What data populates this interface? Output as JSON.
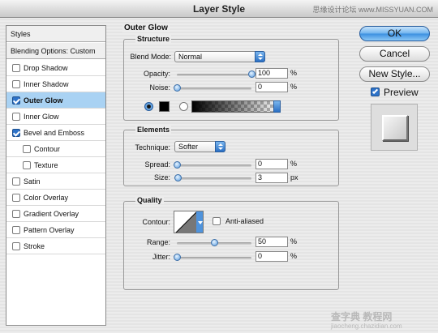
{
  "window": {
    "title": "Layer Style",
    "watermark": "思缘设计论坛 www.MISSYUAN.COM"
  },
  "styles_list": {
    "header": "Styles",
    "blending": "Blending Options: Custom",
    "items": [
      {
        "label": "Drop Shadow",
        "checked": false,
        "selected": false,
        "sub": false
      },
      {
        "label": "Inner Shadow",
        "checked": false,
        "selected": false,
        "sub": false
      },
      {
        "label": "Outer Glow",
        "checked": true,
        "selected": true,
        "sub": false
      },
      {
        "label": "Inner Glow",
        "checked": false,
        "selected": false,
        "sub": false
      },
      {
        "label": "Bevel and Emboss",
        "checked": true,
        "selected": false,
        "sub": false
      },
      {
        "label": "Contour",
        "checked": false,
        "selected": false,
        "sub": true
      },
      {
        "label": "Texture",
        "checked": false,
        "selected": false,
        "sub": true
      },
      {
        "label": "Satin",
        "checked": false,
        "selected": false,
        "sub": false
      },
      {
        "label": "Color Overlay",
        "checked": false,
        "selected": false,
        "sub": false
      },
      {
        "label": "Gradient Overlay",
        "checked": false,
        "selected": false,
        "sub": false
      },
      {
        "label": "Pattern Overlay",
        "checked": false,
        "selected": false,
        "sub": false
      },
      {
        "label": "Stroke",
        "checked": false,
        "selected": false,
        "sub": false
      }
    ]
  },
  "outer_glow": {
    "title": "Outer Glow",
    "structure": {
      "title": "Structure",
      "blend_mode_label": "Blend Mode:",
      "blend_mode_value": "Normal",
      "opacity_label": "Opacity:",
      "opacity_value": "100",
      "opacity_level": 1.0,
      "noise_label": "Noise:",
      "noise_value": "0",
      "noise_level": 0,
      "pct": "%",
      "color_swatch": "#000000"
    },
    "elements": {
      "title": "Elements",
      "technique_label": "Technique:",
      "technique_value": "Softer",
      "spread_label": "Spread:",
      "spread_value": "0",
      "spread_level": 0,
      "size_label": "Size:",
      "size_value": "3",
      "size_level": 0.012,
      "px": "px",
      "pct": "%"
    },
    "quality": {
      "title": "Quality",
      "contour_label": "Contour:",
      "antialiased_label": "Anti-aliased",
      "antialiased_checked": false,
      "range_label": "Range:",
      "range_value": "50",
      "range_level": 0.5,
      "jitter_label": "Jitter:",
      "jitter_value": "0",
      "jitter_level": 0,
      "pct": "%"
    }
  },
  "buttons": {
    "ok": "OK",
    "cancel": "Cancel",
    "new_style": "New Style..."
  },
  "preview": {
    "label": "Preview",
    "checked": true
  },
  "footer_watermark": "查字典 教程网",
  "footer_url": "jiaocheng.chazidian.com"
}
